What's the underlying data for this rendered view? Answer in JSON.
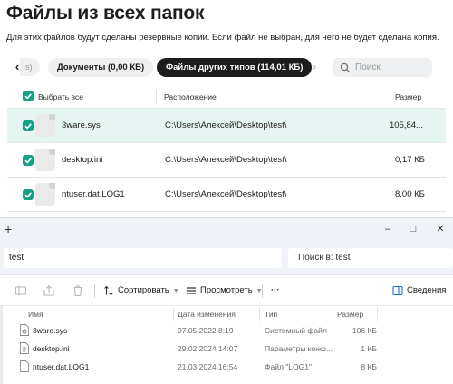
{
  "app": {
    "title": "Файлы из всех папок",
    "description": "Для этих файлов будут сделаны резервные копии. Если файл не выбран, для него не будет сделана копия.",
    "nav_prev_stub": "s)",
    "tabs": [
      {
        "label": "Документы (0,00 КБ)",
        "active": false
      },
      {
        "label": "Файлы других типов (114,01 КБ)",
        "active": true
      }
    ],
    "search_placeholder": "Поиск",
    "table": {
      "select_all_label": "Выбрать все",
      "col_location": "Расположение",
      "col_size": "Размер",
      "rows": [
        {
          "name": "3ware.sys",
          "location": "C:\\Users\\Алексей\\Desktop\\test\\",
          "size": "105,84...",
          "checked": true,
          "selected": true
        },
        {
          "name": "desktop.ini",
          "location": "C:\\Users\\Алексей\\Desktop\\test\\",
          "size": "0,17 КБ",
          "checked": true,
          "selected": false
        },
        {
          "name": "ntuser.dat.LOG1",
          "location": "C:\\Users\\Алексей\\Desktop\\test\\",
          "size": "8,00 КБ",
          "checked": true,
          "selected": false
        }
      ]
    },
    "colors": {
      "accent": "#16a085",
      "selected_row": "#e5f5f1",
      "active_tab": "#1d1d1b"
    }
  },
  "explorer": {
    "new_tab_glyph": "+",
    "window_controls": [
      "–",
      "□",
      "✕"
    ],
    "address": "test",
    "search_placeholder": "Поиск в: test",
    "toolbar": {
      "sort_label": "Сортировать",
      "view_label": "Просмотреть",
      "more_label": "···",
      "details_label": "Сведения"
    },
    "columns": {
      "name": "Имя",
      "date": "Дата изменения",
      "type": "Тип",
      "size": "Размер"
    },
    "files": [
      {
        "name": "3ware.sys",
        "date": "07.05.2022 8:19",
        "type": "Системный файл",
        "size": "106 КБ"
      },
      {
        "name": "desktop.ini",
        "date": "29.02.2024 14:07",
        "type": "Параметры конф...",
        "size": "1 КБ"
      },
      {
        "name": "ntuser.dat.LOG1",
        "date": "21.03.2024 16:54",
        "type": "Файл \"LOG1\"",
        "size": "8 КБ"
      }
    ]
  }
}
